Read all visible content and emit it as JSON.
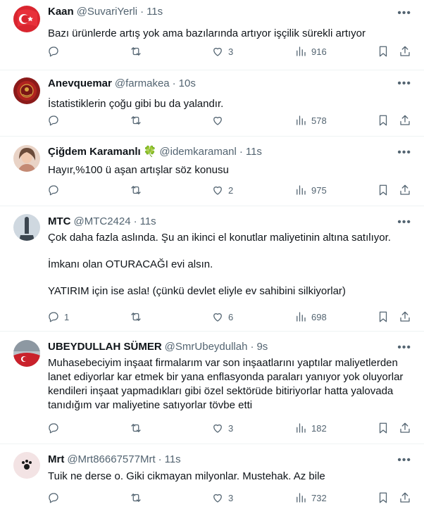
{
  "tweets": [
    {
      "name": "Kaan",
      "handle": "@SuvariYerli",
      "time": "11s",
      "lines": [
        "Bazı ürünlerde artış yok ama bazılarında artıyor işçilik sürekli artıyor"
      ],
      "replies": "",
      "retweets": "",
      "likes": "3",
      "views": "916",
      "avatar": "turkish-flag"
    },
    {
      "name": "Anevquemar",
      "handle": "@farmakea",
      "time": "10s",
      "lines": [
        "İstatistiklerin çoğu gibi bu da yalandır."
      ],
      "replies": "",
      "retweets": "",
      "likes": "",
      "views": "578",
      "avatar": "ottoman-emblem"
    },
    {
      "name": "Çiğdem Karamanlı",
      "emoji": "🍀",
      "handle": "@idemkaramanl",
      "time": "11s",
      "lines": [
        "Hayır,%100 ü aşan artışlar söz konusu"
      ],
      "replies": "",
      "retweets": "",
      "likes": "2",
      "views": "975",
      "avatar": "portrait"
    },
    {
      "name": "MTC",
      "handle": "@MTC2424",
      "time": "11s",
      "lines": [
        "Çok daha fazla aslında. Şu an ikinci el konutlar maliyetinin altına satılıyor.",
        "",
        "İmkanı olan OTURACAĞI evi alsın.",
        "",
        "YATIRIM için ise asla! (çünkü devlet eliyle ev sahibini silkiyorlar)"
      ],
      "replies": "1",
      "retweets": "",
      "likes": "6",
      "views": "698",
      "avatar": "statue"
    },
    {
      "name": "UBEYDULLAH SÜMER",
      "handle": "@SmrUbeydullah",
      "time": "9s",
      "lines": [
        "Muhasebeciyim inşaat firmalarım var son inşaatlarını yaptılar maliyetlerden",
        "lanet ediyorlar kar etmek bir yana enflasyonda paraları yanıyor yok oluyorlar",
        "kendileri inşaat yapmadıkları gibi özel sektörüde bitiriyorlar hatta yalovada",
        "tanıdığım var maliyetine satıyorlar tövbe etti"
      ],
      "replies": "",
      "retweets": "",
      "likes": "3",
      "views": "182",
      "avatar": "flag-landscape"
    },
    {
      "name": "Mrt",
      "handle": "@Mrt86667577Mrt",
      "time": "11s",
      "lines": [
        "Tuik ne derse o. Giki cikmayan milyonlar. Mustehak. Az bile"
      ],
      "replies": "",
      "retweets": "",
      "likes": "3",
      "views": "732",
      "avatar": "paw"
    }
  ]
}
